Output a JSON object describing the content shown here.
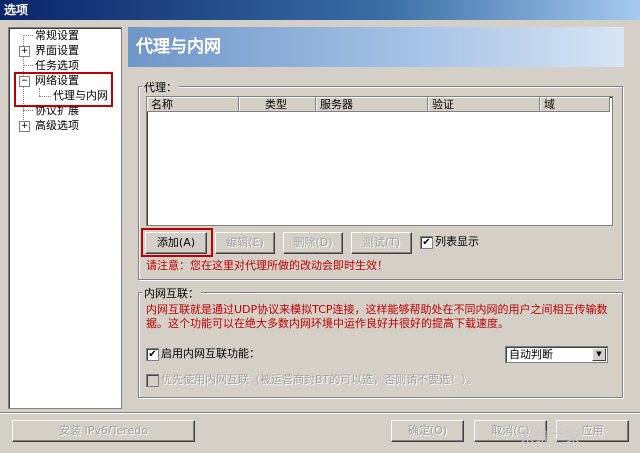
{
  "window": {
    "title": "选项"
  },
  "tree": {
    "items": [
      {
        "label": "常规设置",
        "toggle": ""
      },
      {
        "label": "界面设置",
        "toggle": "+"
      },
      {
        "label": "任务选项",
        "toggle": ""
      },
      {
        "label": "网络设置",
        "toggle": "−"
      },
      {
        "label": "代理与内网",
        "toggle": ""
      },
      {
        "label": "协议扩展",
        "toggle": ""
      },
      {
        "label": "高级选项",
        "toggle": "+"
      }
    ]
  },
  "panel": {
    "title": "代理与内网",
    "proxy": {
      "group_label": "代理：",
      "columns": [
        "名称",
        "类型",
        "服务器",
        "验证",
        "域"
      ],
      "buttons": {
        "add": "添加(A)",
        "edit": "编辑(E)",
        "delete": "删除(D)",
        "test": "测试(T)"
      },
      "list_display": {
        "label": "列表显示",
        "checked": "✔"
      },
      "notice": "请注意：您在这里对代理所做的改动会即时生效！"
    },
    "intranet": {
      "group_label": "内网互联：",
      "description_line1": "内网互联就是通过UDP协议来模拟TCP连接，这样能够帮助处在不同内网的用户之间相互传输数",
      "description_line2": "据。这个功能可以在绝大多数内网环境中运作良好并很好的提高下载速度。",
      "enable": {
        "label": "启用内网互联功能：",
        "checked": "✔"
      },
      "mode_select": {
        "value": "自动判断"
      },
      "prefer": {
        "label": "优先使用内网互联（被运营商封BT的可以选，否则请不要选！）。"
      }
    }
  },
  "footer": {
    "install_ipv6": "安装 IPv6/Teredo",
    "ok": "确定(O)",
    "cancel": "取消(C)",
    "apply": "应用"
  },
  "watermark": "系统之家"
}
